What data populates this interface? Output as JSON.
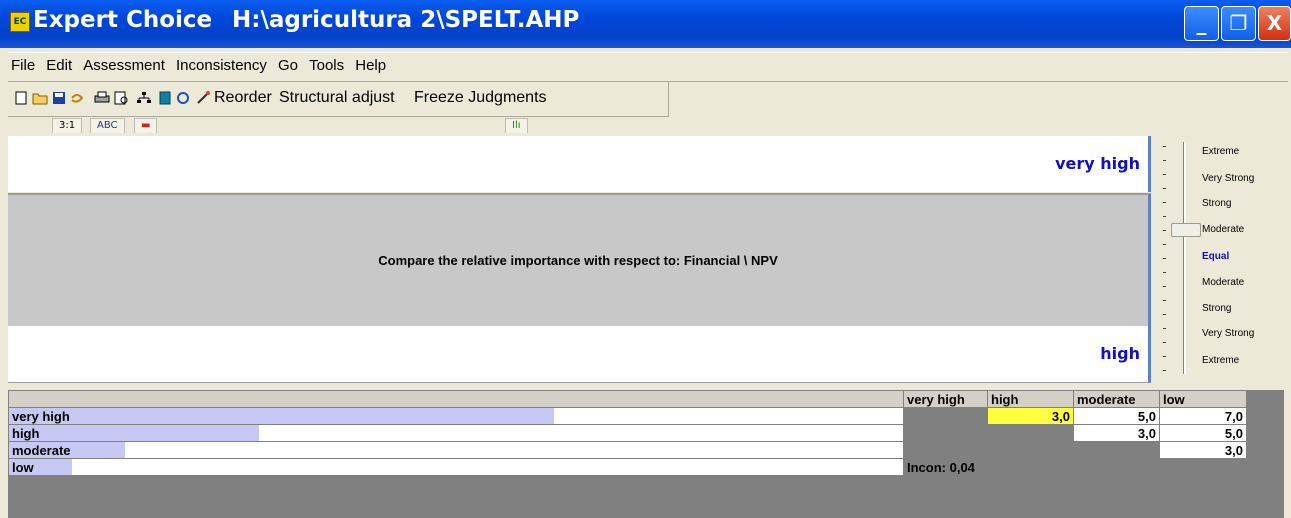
{
  "title": {
    "app": "Expert Choice",
    "path": "H:\\agricultura 2\\SPELT.AHP",
    "logo": "EC",
    "min": "_",
    "max": "❐",
    "close": "X"
  },
  "menu": [
    "File",
    "Edit",
    "Assessment",
    "Inconsistency",
    "Go",
    "Tools",
    "Help"
  ],
  "toolbar": {
    "reorder": "Reorder",
    "structural_adjust": "Structural adjust",
    "freeze": "Freeze Judgments"
  },
  "tabs": [
    "3:1",
    "ABC",
    "▬",
    "Ilı"
  ],
  "comparison": {
    "top_item": "very high",
    "bottom_item": "high",
    "prompt": "Compare the relative importance  with respect to: Financial  \\ NPV"
  },
  "scale": [
    "Extreme",
    "Very Strong",
    "Strong",
    "Moderate",
    "Equal",
    "Moderate",
    "Strong",
    "Very Strong",
    "Extreme"
  ],
  "matrix": {
    "columns": [
      "very high",
      "high",
      "moderate",
      "low"
    ],
    "rows": [
      {
        "name": "very high",
        "bar": 0.61,
        "cells": [
          "",
          "3,0",
          "5,0",
          "7,0"
        ]
      },
      {
        "name": "high",
        "bar": 0.28,
        "cells": [
          "",
          "",
          "3,0",
          "5,0"
        ]
      },
      {
        "name": "moderate",
        "bar": 0.13,
        "cells": [
          "",
          "",
          "",
          "3,0"
        ]
      },
      {
        "name": "low",
        "bar": 0.07,
        "cells": [
          "Incon: 0,04",
          "",
          "",
          ""
        ]
      }
    ]
  },
  "colors": {
    "title_bar": "#0046d8",
    "highlight_cell": "#ffff40",
    "item_text": "#1010c8",
    "bar": "#c8c8f4"
  }
}
